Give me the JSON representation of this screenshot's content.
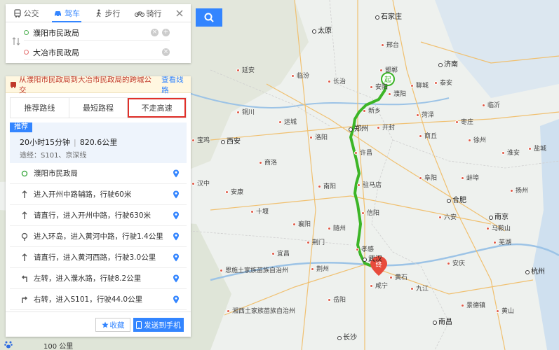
{
  "modes": [
    {
      "label": "公交",
      "icon": "bus-icon"
    },
    {
      "label": "驾车",
      "icon": "car-icon"
    },
    {
      "label": "步行",
      "icon": "walk-icon"
    },
    {
      "label": "骑行",
      "icon": "bike-icon"
    }
  ],
  "active_mode": "驾车",
  "start": "濮阳市民政局",
  "end": "大冶市民政局",
  "banner": {
    "text": "从濮阳市民政局到大冶市民政局的跨城公交",
    "link": "查看线路"
  },
  "route_tabs": [
    "推荐路线",
    "最短路程",
    "不走高速"
  ],
  "summary": {
    "tag": "推荐",
    "duration": "20小时15分钟",
    "distance": "820.6公里",
    "via": "途经：S101、京深线"
  },
  "steps": [
    {
      "text": "濮阳市民政局",
      "icon": "start-pin-icon"
    },
    {
      "text": "进入开州中路辅路，行驶60米",
      "icon": "arrow-up-icon"
    },
    {
      "text": "请直行，进入开州中路，行驶630米",
      "icon": "arrow-up-icon"
    },
    {
      "text": "进入环岛，进入黄河中路，行驶1.4公里",
      "icon": "roundabout-icon"
    },
    {
      "text": "请直行，进入黄河西路，行驶3.0公里",
      "icon": "arrow-up-icon"
    },
    {
      "text": "左转，进入濮水路，行驶8.2公里",
      "icon": "turn-left-icon"
    },
    {
      "text": "右转，进入S101，行驶44.0公里",
      "icon": "turn-right-icon"
    }
  ],
  "footer": {
    "fav": "收藏",
    "send": "发送到手机"
  },
  "scale_text": "100 公里",
  "markers": {
    "start_label": "起",
    "end_label": "终"
  },
  "colors": {
    "accent": "#3385ff",
    "route": "#3cb526",
    "highlight_box": "#e0302a"
  },
  "cities": [
    {
      "name": "石家庄",
      "big": true
    },
    {
      "name": "太原",
      "big": true
    },
    {
      "name": "济南",
      "big": true
    },
    {
      "name": "郑州",
      "big": true
    },
    {
      "name": "西安",
      "big": true
    },
    {
      "name": "合肥",
      "big": true
    },
    {
      "name": "南京",
      "big": true
    },
    {
      "name": "武汉",
      "big": true
    },
    {
      "name": "杭州",
      "big": true
    },
    {
      "name": "长沙",
      "big": true
    },
    {
      "name": "南昌",
      "big": true
    },
    {
      "name": "黄石",
      "big": false
    },
    {
      "name": "濮阳",
      "big": false
    },
    {
      "name": "许昌",
      "big": false
    },
    {
      "name": "驻马店",
      "big": false
    },
    {
      "name": "信阳",
      "big": false
    },
    {
      "name": "孝感",
      "big": false
    },
    {
      "name": "咸宁",
      "big": false
    },
    {
      "name": "九江",
      "big": false
    },
    {
      "name": "安庆",
      "big": false
    },
    {
      "name": "南阳",
      "big": false
    },
    {
      "name": "襄阳",
      "big": false
    },
    {
      "name": "荆门",
      "big": false
    },
    {
      "name": "荆州",
      "big": false
    },
    {
      "name": "宜昌",
      "big": false
    },
    {
      "name": "洛阳",
      "big": false
    },
    {
      "name": "开封",
      "big": false
    },
    {
      "name": "商丘",
      "big": false
    },
    {
      "name": "新乡",
      "big": false
    },
    {
      "name": "安阳",
      "big": false
    },
    {
      "name": "邯郸",
      "big": false
    },
    {
      "name": "邢台",
      "big": false
    },
    {
      "name": "聊城",
      "big": false
    },
    {
      "name": "菏泽",
      "big": false
    },
    {
      "name": "徐州",
      "big": false
    },
    {
      "name": "蚌埠",
      "big": false
    },
    {
      "name": "阜阳",
      "big": false
    },
    {
      "name": "六安",
      "big": false
    },
    {
      "name": "随州",
      "big": false
    },
    {
      "name": "十堰",
      "big": false
    },
    {
      "name": "岳阳",
      "big": false
    },
    {
      "name": "临汾",
      "big": false
    },
    {
      "name": "长治",
      "big": false
    },
    {
      "name": "运城",
      "big": false
    },
    {
      "name": "延安",
      "big": false
    },
    {
      "name": "铜川",
      "big": false
    },
    {
      "name": "宝鸡",
      "big": false
    },
    {
      "name": "汉中",
      "big": false
    },
    {
      "name": "安康",
      "big": false
    },
    {
      "name": "商洛",
      "big": false
    },
    {
      "name": "泰安",
      "big": false
    },
    {
      "name": "枣庄",
      "big": false
    },
    {
      "name": "临沂",
      "big": false
    },
    {
      "name": "淮安",
      "big": false
    },
    {
      "name": "盐城",
      "big": false
    },
    {
      "name": "扬州",
      "big": false
    },
    {
      "name": "马鞍山",
      "big": false
    },
    {
      "name": "芜湖",
      "big": false
    },
    {
      "name": "黄山",
      "big": false
    },
    {
      "name": "景德镇",
      "big": false
    },
    {
      "name": "恩施土家族苗族自治州",
      "big": false
    },
    {
      "name": "湘西土家族苗族自治州",
      "big": false
    }
  ]
}
